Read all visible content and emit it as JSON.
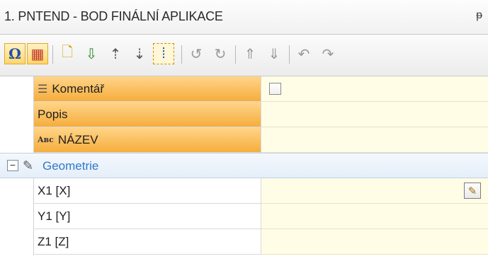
{
  "window": {
    "title": "1. PNTEND - BOD FINÁLNÍ APLIKACE",
    "pin_icon": "ᵽ"
  },
  "toolbar": {
    "buttons": [
      {
        "name": "omega-icon",
        "glyph": "Ω"
      },
      {
        "name": "grid-view-icon",
        "glyph": "▦"
      },
      {
        "name": "new-document-icon",
        "glyph": "🗋"
      },
      {
        "name": "import-icon",
        "glyph": "⇩"
      },
      {
        "name": "sort-up-icon",
        "glyph": "⇡"
      },
      {
        "name": "sort-down-icon",
        "glyph": "⇣"
      },
      {
        "name": "select-icon",
        "glyph": "⁞"
      },
      {
        "name": "rotate-left-icon",
        "glyph": "↺"
      },
      {
        "name": "rotate-right-icon",
        "glyph": "↻"
      },
      {
        "name": "move-up-icon",
        "glyph": "⇑"
      },
      {
        "name": "move-down-icon",
        "glyph": "⇓"
      },
      {
        "name": "undo-icon",
        "glyph": "↶"
      },
      {
        "name": "redo-icon",
        "glyph": "↷"
      }
    ]
  },
  "properties": {
    "comment_label": "Komentář",
    "comment_checked": false,
    "popis_label": "Popis",
    "popis_value": "",
    "nazev_label": "NÁZEV",
    "nazev_value": "",
    "group_label": "Geometrie",
    "group_toggle": "−",
    "x1_label": "X1 [X]",
    "x1_value": "",
    "y1_label": "Y1 [Y]",
    "y1_value": "",
    "z1_label": "Z1 [Z]",
    "z1_value": ""
  },
  "colors": {
    "header_accent": "#f6ad3c",
    "value_bg": "#fffde6",
    "group_text": "#2f79c7"
  }
}
